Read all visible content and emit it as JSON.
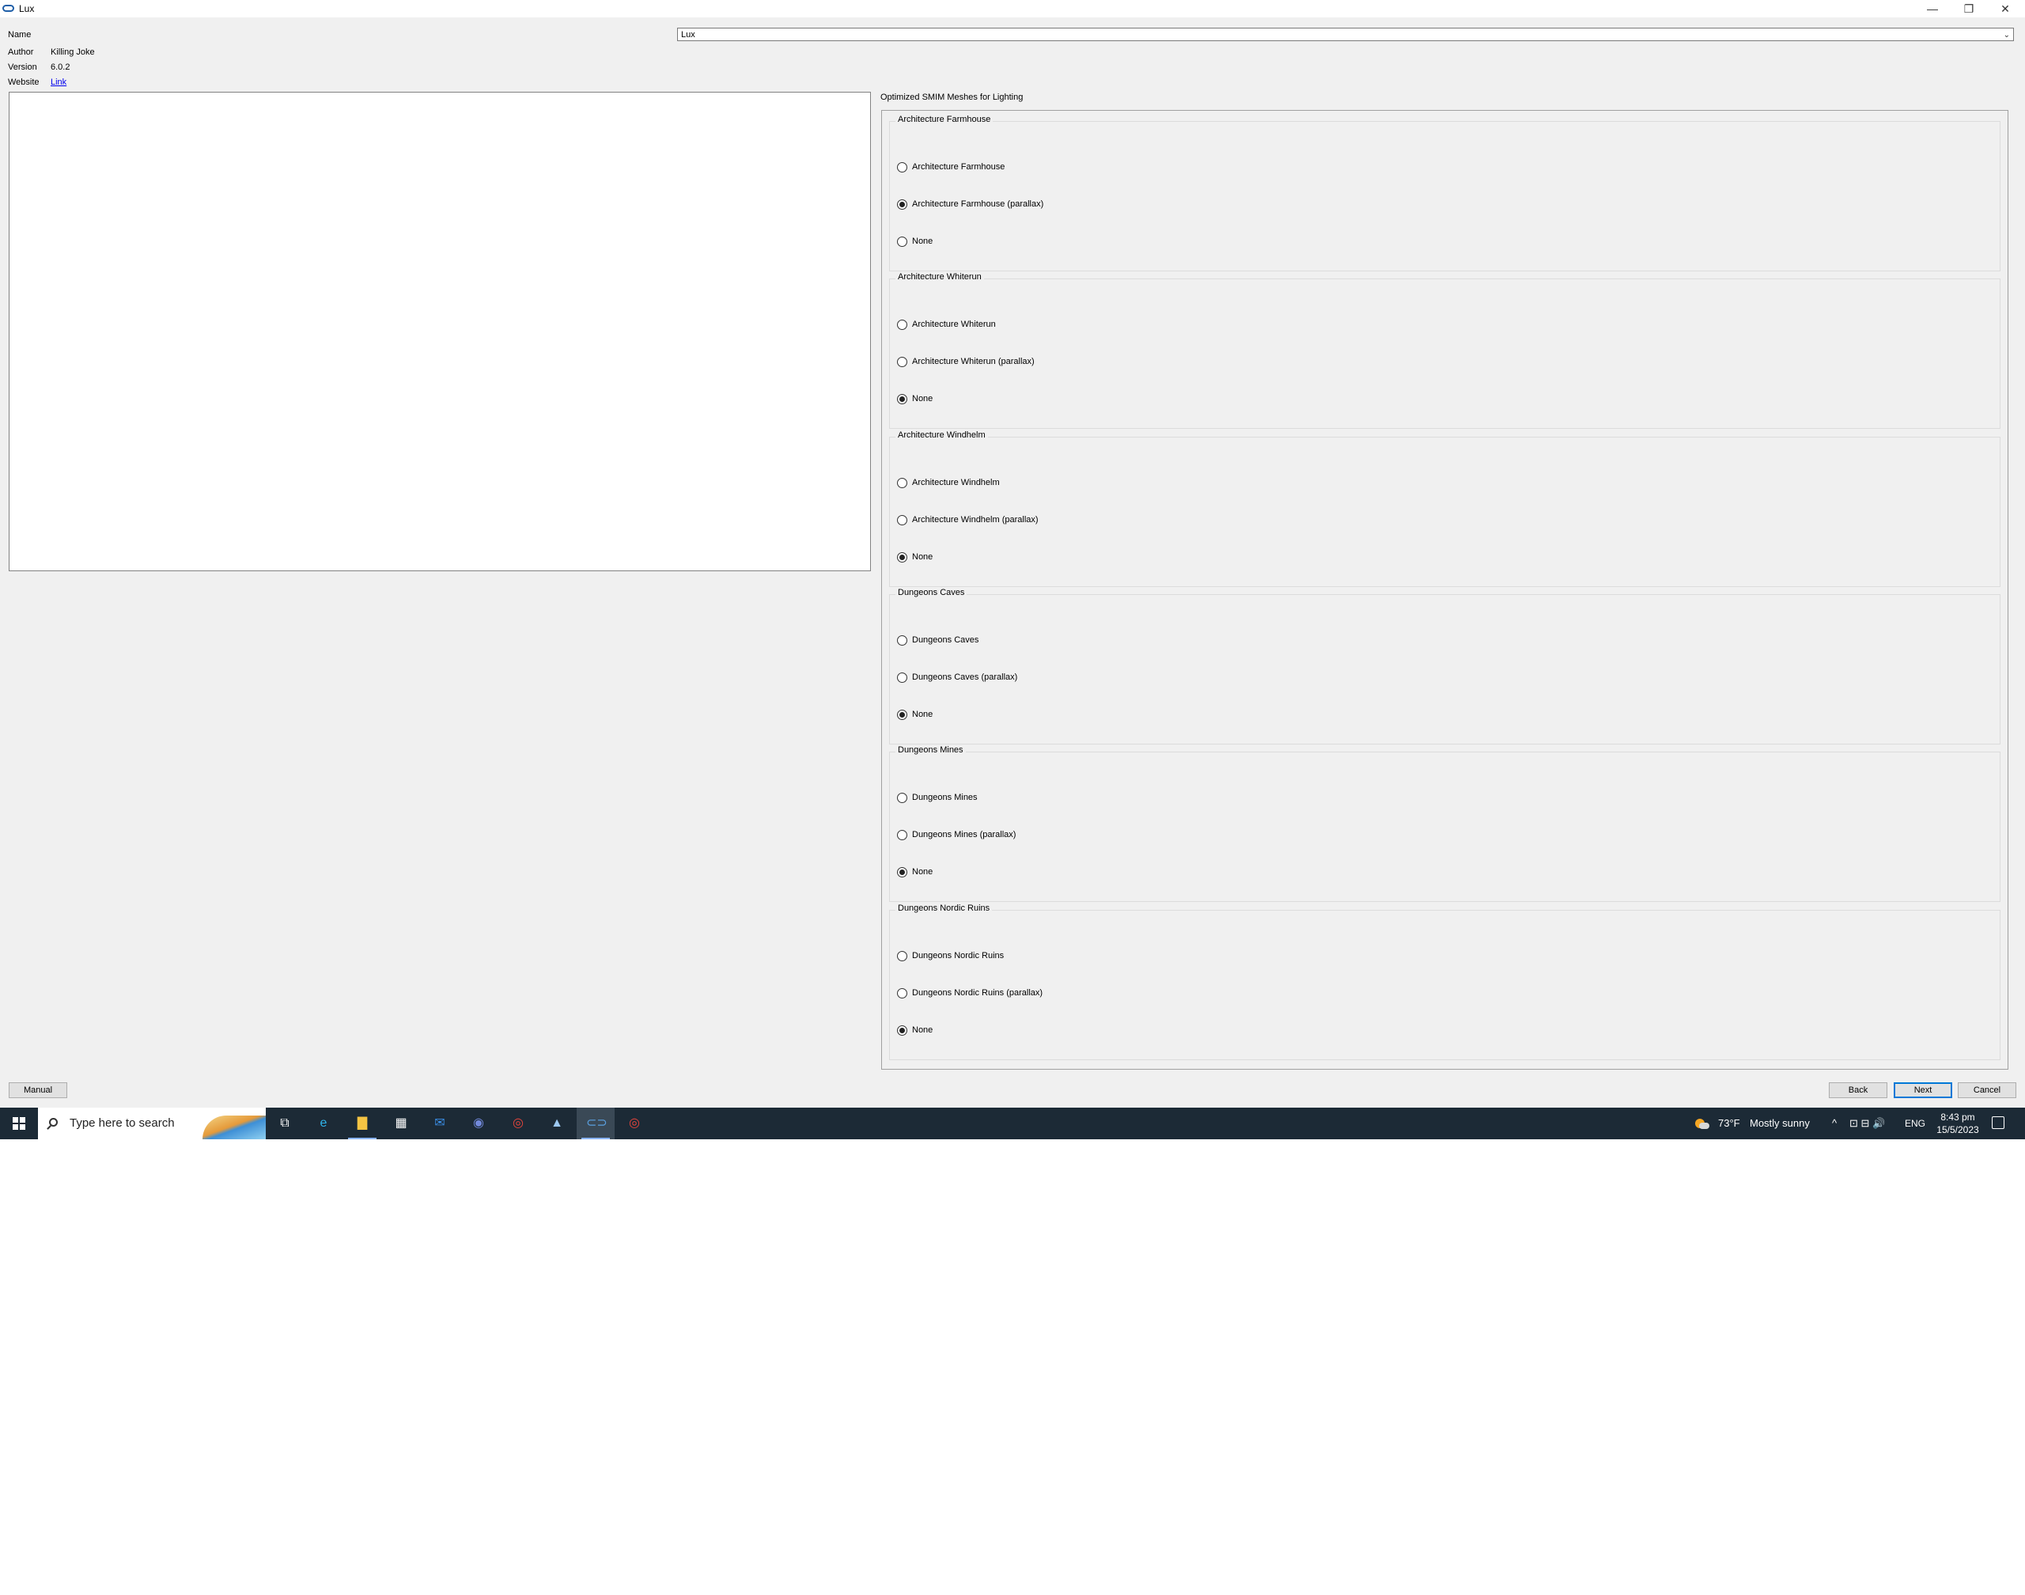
{
  "window": {
    "title": "Lux",
    "minimize_glyph": "—",
    "restore_glyph": "❐",
    "close_glyph": "✕"
  },
  "info": {
    "name_label": "Name",
    "name_value": "Lux",
    "author_label": "Author",
    "author_value": "Killing Joke",
    "version_label": "Version",
    "version_value": "6.0.2",
    "website_label": "Website",
    "website_link": "Link"
  },
  "options": {
    "title": "Optimized SMIM Meshes for Lighting",
    "groups": [
      {
        "title": "Architecture Farmhouse",
        "items": [
          {
            "label": "Architecture Farmhouse",
            "checked": false
          },
          {
            "label": "Architecture Farmhouse (parallax)",
            "checked": true
          },
          {
            "label": "None",
            "checked": false
          }
        ]
      },
      {
        "title": "Architecture Whiterun",
        "items": [
          {
            "label": "Architecture Whiterun",
            "checked": false
          },
          {
            "label": "Architecture Whiterun (parallax)",
            "checked": false
          },
          {
            "label": "None",
            "checked": true
          }
        ]
      },
      {
        "title": "Architecture Windhelm",
        "items": [
          {
            "label": "Architecture Windhelm",
            "checked": false
          },
          {
            "label": "Architecture Windhelm (parallax)",
            "checked": false
          },
          {
            "label": "None",
            "checked": true
          }
        ]
      },
      {
        "title": "Dungeons Caves",
        "items": [
          {
            "label": "Dungeons Caves",
            "checked": false
          },
          {
            "label": "Dungeons Caves (parallax)",
            "checked": false
          },
          {
            "label": "None",
            "checked": true
          }
        ]
      },
      {
        "title": "Dungeons Mines",
        "items": [
          {
            "label": "Dungeons Mines",
            "checked": false
          },
          {
            "label": "Dungeons Mines (parallax)",
            "checked": false
          },
          {
            "label": "None",
            "checked": true
          }
        ]
      },
      {
        "title": "Dungeons Nordic Ruins",
        "items": [
          {
            "label": "Dungeons Nordic Ruins",
            "checked": false
          },
          {
            "label": "Dungeons Nordic Ruins (parallax)",
            "checked": false
          },
          {
            "label": "None",
            "checked": true
          }
        ]
      }
    ]
  },
  "buttons": {
    "manual": "Manual",
    "back": "Back",
    "next": "Next",
    "cancel": "Cancel"
  },
  "taskbar": {
    "search_placeholder": "Type here to search",
    "weather_temp": "73°F",
    "weather_desc": "Mostly sunny",
    "language": "ENG",
    "time": "8:43 pm",
    "date": "15/5/2023",
    "tray_chevron": "^",
    "tray_glyphs": "⊡ ⊟ 🔊",
    "icons": [
      "task-view-icon",
      "edge-icon",
      "file-explorer-icon",
      "store-icon",
      "mail-icon",
      "discord-icon",
      "chrome-icon",
      "app-icon",
      "mod-organizer-icon",
      "chrome-profile-icon"
    ],
    "icon_glyphs": [
      "⧉",
      "e",
      "▇",
      "▦",
      "✉",
      "◉",
      "◎",
      "▲",
      "⊂⊃",
      "◎"
    ]
  }
}
